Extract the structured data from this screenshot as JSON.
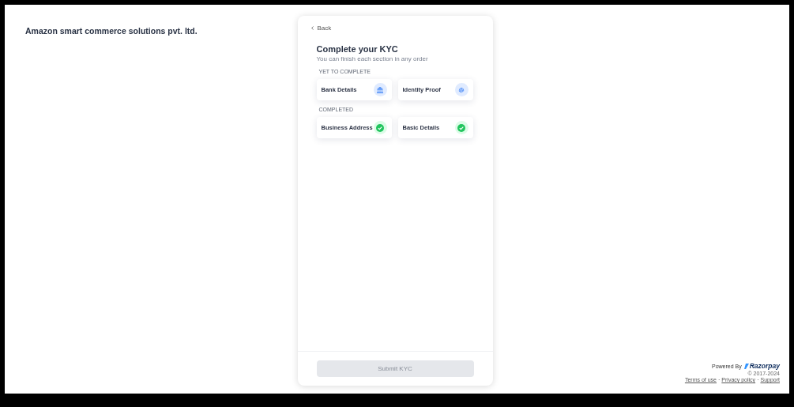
{
  "merchant_name": "Amazon smart commerce solutions pvt. ltd.",
  "card": {
    "back_label": "Back",
    "title": "Complete your KYC",
    "subtitle": "You can finish each section in any order",
    "sections": [
      {
        "heading": "YET TO COMPLETE",
        "items": [
          {
            "label": "Bank Details",
            "kind": "bank",
            "completed": false
          },
          {
            "label": "Identity Proof",
            "kind": "identity",
            "completed": false
          }
        ]
      },
      {
        "heading": "COMPLETED",
        "items": [
          {
            "label": "Business Address",
            "completed": true
          },
          {
            "label": "Basic Details",
            "completed": true
          }
        ]
      }
    ],
    "submit": {
      "label": "Submit KYC",
      "disabled": true
    }
  },
  "footer": {
    "powered_by": "Powered By",
    "brand": "Razorpay",
    "copyright": "© 2017-2024",
    "links": [
      "Terms of use",
      "Privacy policy",
      "Support"
    ],
    "link_separator": "·"
  }
}
